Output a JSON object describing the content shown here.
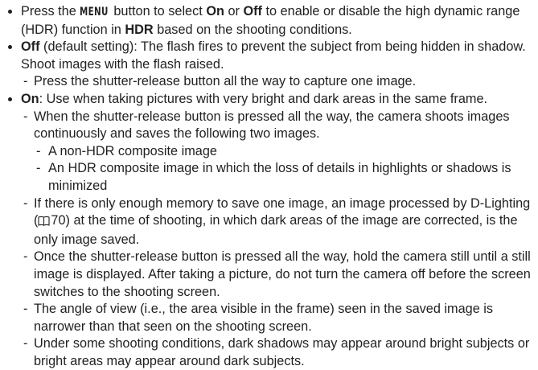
{
  "items": [
    {
      "parts": {
        "a": "Press the ",
        "key": "MENU",
        "b": " button to select ",
        "on": "On",
        "c": " or ",
        "off": "Off",
        "d": " to enable or disable the high dynamic range (HDR) function in ",
        "hdr": "HDR",
        "e": " based on the shooting conditions."
      }
    },
    {
      "term": "Off",
      "text": " (default setting): The flash fires to prevent the subject from being hidden in shadow. Shoot images with the flash raised.",
      "subs": [
        "Press the shutter-release button all the way to capture one image."
      ]
    },
    {
      "term": "On",
      "text": ": Use when taking pictures with very bright and dark areas in the same frame.",
      "sub1": "When the shutter-release button is pressed all the way, the camera shoots images continuously and saves the following two images.",
      "sub1_items": [
        "A non-HDR composite image",
        "An HDR composite image in which the loss of details in highlights or shadows is minimized"
      ],
      "sub2_a": "If there is only enough memory to save one image, an image processed by D-Lighting (",
      "sub2_ref": "70",
      "sub2_b": ") at the time of shooting, in which dark areas of the image are corrected, is the only image saved.",
      "sub3": "Once the shutter-release button is pressed all the way, hold the camera still until a still image is displayed. After taking a picture, do not turn the camera off before the screen switches to the shooting screen.",
      "sub4": "The angle of view (i.e., the area visible in the frame) seen in the saved image is narrower than that seen on the shooting screen.",
      "sub5": "Under some shooting conditions, dark shadows may appear around bright subjects or bright areas may appear around dark subjects."
    }
  ],
  "dash": "-"
}
